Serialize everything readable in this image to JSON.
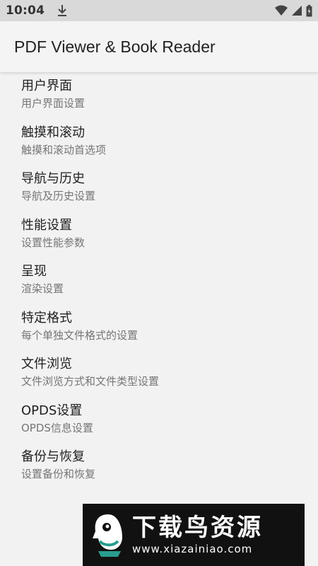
{
  "status_bar": {
    "time": "10:04",
    "download_icon": "download-icon",
    "wifi_icon": "wifi-icon",
    "signal_icon": "cell-signal-icon",
    "battery_icon": "battery-icon"
  },
  "app_bar": {
    "title": "PDF Viewer & Book Reader"
  },
  "settings": [
    {
      "title": "用户界面",
      "summary": "用户界面设置"
    },
    {
      "title": "触摸和滚动",
      "summary": "触摸和滚动首选项"
    },
    {
      "title": "导航与历史",
      "summary": "导航及历史设置"
    },
    {
      "title": "性能设置",
      "summary": "设置性能参数"
    },
    {
      "title": "呈现",
      "summary": "渲染设置"
    },
    {
      "title": "特定格式",
      "summary": "每个单独文件格式的设置"
    },
    {
      "title": "文件浏览",
      "summary": "文件浏览方式和文件类型设置"
    },
    {
      "title": "OPDS设置",
      "summary": "OPDS信息设置"
    },
    {
      "title": "备份与恢复",
      "summary": "设置备份和恢复"
    }
  ],
  "watermark": {
    "name": "下载鸟资源",
    "url": "www.xiazainiao.com"
  }
}
